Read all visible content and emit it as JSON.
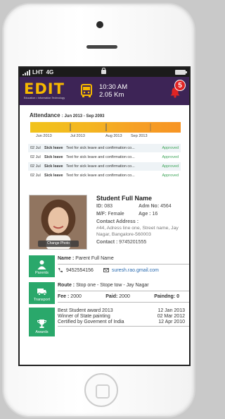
{
  "statusbar": {
    "carrier": "LHT",
    "network": "4G"
  },
  "header": {
    "logo": "EDIT",
    "tagline": "Education • Information Technology",
    "time": "10:30 AM",
    "distance": "2.05 Km",
    "notifications": "5",
    "colors": {
      "header_bg": "#3d2456",
      "logo": "#f6b800",
      "badge": "#e02424"
    }
  },
  "attendance": {
    "title": "Attendance",
    "range": ": Jun 2013 - Sep 2093",
    "months": [
      "Jun 2013",
      "Jul 2013",
      "Aug 2013",
      "Sep 2013"
    ]
  },
  "leaves": [
    {
      "date": "02 Jul",
      "type": "Sick leave",
      "desc": "Text for sick leave and confirmation co...",
      "status": "Approved"
    },
    {
      "date": "02 Jul",
      "type": "Sick leave",
      "desc": "Text for sick leave and confirmation co...",
      "status": "Approved"
    },
    {
      "date": "02 Jul",
      "type": "Sick leave",
      "desc": "Text for sick leave and confirmation co...",
      "status": "Approved"
    },
    {
      "date": "02 Jul",
      "type": "Sick leave",
      "desc": "Text for sick leave and confirmation co...",
      "status": "Approved"
    }
  ],
  "student": {
    "change_photo": "Change Photo",
    "name": "Student Full Name",
    "id_label": "ID:",
    "id": "083",
    "adm_label": "Adm No:",
    "adm": "4564",
    "gender_label": "M/F:",
    "gender": "Female",
    "age_label": "Age :",
    "age": "16",
    "address_label": "Contact Address :",
    "address": "#44, Adress line one, Street name, Jay Nagar, Bangalore-560003",
    "contact_label": "Contact :",
    "contact": "9745201555"
  },
  "parents": {
    "tile": "Parents",
    "name_label": "Name :",
    "name": "Parent Full Name",
    "phone": "9452554156",
    "email": "suresh.rao.gmail.com"
  },
  "transport": {
    "tile": "Transport",
    "route_label": "Route :",
    "route": "Stop one - Stope tow - Jay Nagar",
    "fee_label": "Fee :",
    "fee": "2000",
    "paid_label": "Paid:",
    "paid": "2000",
    "pending_label": "Paindng:",
    "pending": "0"
  },
  "awards": {
    "tile": "Awards",
    "items": [
      {
        "title": "Best Student award 2013",
        "date": "12 Jan 2013"
      },
      {
        "title": "Winner of State painting",
        "date": "02 Mar 2012"
      },
      {
        "title": "Certified by Govement of India",
        "date": "12 Apr 2010"
      }
    ]
  }
}
